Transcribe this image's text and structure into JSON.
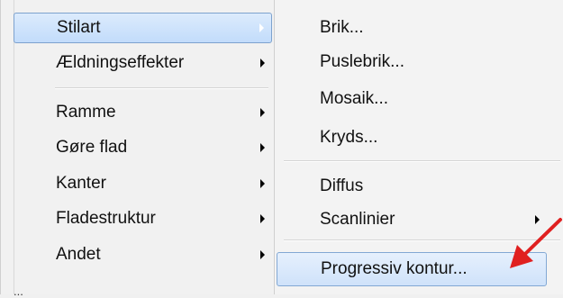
{
  "left_menu": {
    "items": [
      {
        "label": "Stilart",
        "has_submenu": true,
        "selected": true
      },
      {
        "label": "Ældningseffekter",
        "has_submenu": true
      },
      {
        "label": "Ramme",
        "has_submenu": true
      },
      {
        "label": "Gøre flad",
        "has_submenu": true
      },
      {
        "label": "Kanter",
        "has_submenu": true
      },
      {
        "label": "Fladestruktur",
        "has_submenu": true
      },
      {
        "label": "Andet",
        "has_submenu": true
      }
    ],
    "bottom_partial_text": "..."
  },
  "submenu": {
    "items": [
      {
        "label": "Brik..."
      },
      {
        "label": "Puslebrik..."
      },
      {
        "label": "Mosaik..."
      },
      {
        "label": "Kryds..."
      },
      {
        "label": "Diffus"
      },
      {
        "label": "Scanlinier",
        "has_submenu": true
      },
      {
        "label": "Progressiv kontur...",
        "selected": true
      }
    ]
  },
  "annotation": {
    "pointer_color": "#e02020",
    "pointer_icon": "red-arrow-icon"
  }
}
